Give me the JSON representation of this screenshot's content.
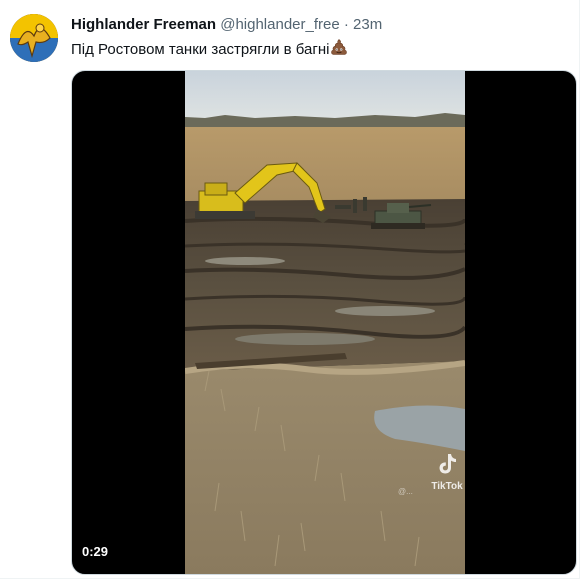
{
  "tweet": {
    "author": {
      "display_name": "Highlander Freeman",
      "handle": "@highlander_free",
      "separator": "·",
      "time": "23m",
      "avatar_icon": "yellow-angel-avatar"
    },
    "text": "Під Ростовом танки застрягли в багні",
    "text_emoji": "pile-of-poo-emoji",
    "media": {
      "type": "video",
      "duration": "0:29",
      "watermark_label": "TikTok",
      "watermark_user": "@..."
    }
  },
  "colors": {
    "text_primary": "#0f1419",
    "text_secondary": "#536471",
    "video_letterbox": "#000000",
    "excavator_yellow": "#e2c51a"
  }
}
